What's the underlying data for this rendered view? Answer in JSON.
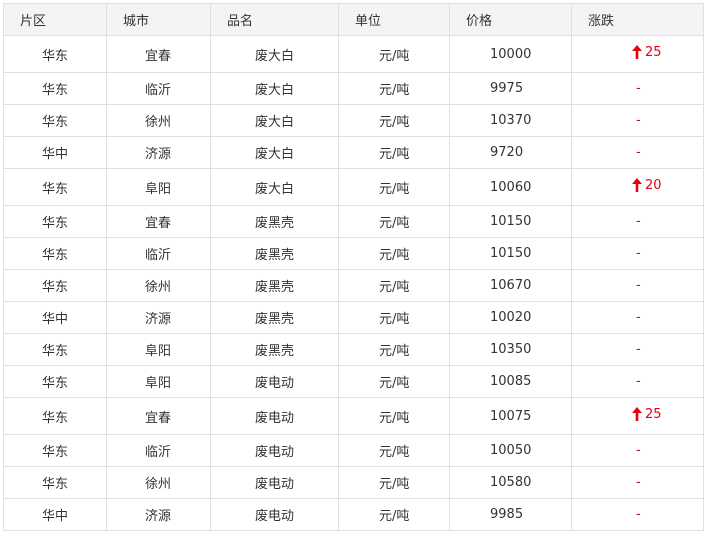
{
  "table": {
    "headers": {
      "region": "片区",
      "city": "城市",
      "name": "品名",
      "unit": "单位",
      "price": "价格",
      "change": "涨跌"
    },
    "rows": [
      {
        "region": "华东",
        "city": "宜春",
        "name": "废大白",
        "unit": "元/吨",
        "price": "10000",
        "change": "25",
        "up": true
      },
      {
        "region": "华东",
        "city": "临沂",
        "name": "废大白",
        "unit": "元/吨",
        "price": "9975",
        "change": "-",
        "up": false
      },
      {
        "region": "华东",
        "city": "徐州",
        "name": "废大白",
        "unit": "元/吨",
        "price": "10370",
        "change": "-",
        "up": false
      },
      {
        "region": "华中",
        "city": "济源",
        "name": "废大白",
        "unit": "元/吨",
        "price": "9720",
        "change": "-",
        "up": false
      },
      {
        "region": "华东",
        "city": "阜阳",
        "name": "废大白",
        "unit": "元/吨",
        "price": "10060",
        "change": "20",
        "up": true
      },
      {
        "region": "华东",
        "city": "宜春",
        "name": "废黑壳",
        "unit": "元/吨",
        "price": "10150",
        "change": "-",
        "up": false
      },
      {
        "region": "华东",
        "city": "临沂",
        "name": "废黑壳",
        "unit": "元/吨",
        "price": "10150",
        "change": "-",
        "up": false
      },
      {
        "region": "华东",
        "city": "徐州",
        "name": "废黑壳",
        "unit": "元/吨",
        "price": "10670",
        "change": "-",
        "up": false
      },
      {
        "region": "华中",
        "city": "济源",
        "name": "废黑壳",
        "unit": "元/吨",
        "price": "10020",
        "change": "-",
        "up": false
      },
      {
        "region": "华东",
        "city": "阜阳",
        "name": "废黑壳",
        "unit": "元/吨",
        "price": "10350",
        "change": "-",
        "up": false
      },
      {
        "region": "华东",
        "city": "阜阳",
        "name": "废电动",
        "unit": "元/吨",
        "price": "10085",
        "change": "-",
        "up": false
      },
      {
        "region": "华东",
        "city": "宜春",
        "name": "废电动",
        "unit": "元/吨",
        "price": "10075",
        "change": "25",
        "up": true
      },
      {
        "region": "华东",
        "city": "临沂",
        "name": "废电动",
        "unit": "元/吨",
        "price": "10050",
        "change": "-",
        "up": false
      },
      {
        "region": "华东",
        "city": "徐州",
        "name": "废电动",
        "unit": "元/吨",
        "price": "10580",
        "change": "-",
        "up": false
      },
      {
        "region": "华中",
        "city": "济源",
        "name": "废电动",
        "unit": "元/吨",
        "price": "9985",
        "change": "-",
        "up": false
      }
    ]
  },
  "colors": {
    "up": "#e60012",
    "header_bg": "#f4f4f4",
    "border": "#e0e0e0",
    "text": "#333333"
  },
  "icons": {
    "up": "arrow-up-icon"
  }
}
